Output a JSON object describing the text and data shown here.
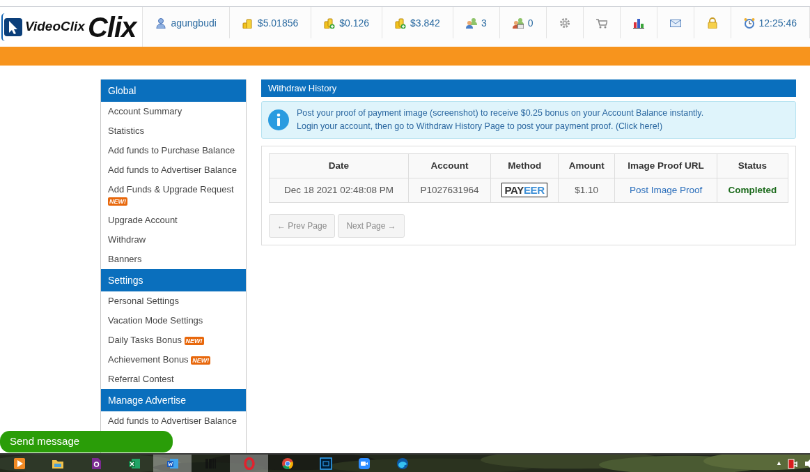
{
  "logo": {
    "label": "VideoClix",
    "wordmark": "Clix"
  },
  "header_items": [
    {
      "kind": "user",
      "text": "agungbudi"
    },
    {
      "kind": "coins",
      "text": "$5.01856"
    },
    {
      "kind": "coins-add",
      "text": "$0.126"
    },
    {
      "kind": "coins-add",
      "text": "$3.842"
    },
    {
      "kind": "referrals",
      "text": "3"
    },
    {
      "kind": "rented",
      "text": "0"
    },
    {
      "kind": "settings"
    },
    {
      "kind": "cart"
    },
    {
      "kind": "stats"
    },
    {
      "kind": "mail"
    },
    {
      "kind": "lock"
    },
    {
      "kind": "clock",
      "text": "12:25:46"
    }
  ],
  "sidebar": [
    {
      "title": "Global",
      "items": [
        {
          "label": "Account Summary"
        },
        {
          "label": "Statistics"
        },
        {
          "label": "Add funds to Purchase Balance"
        },
        {
          "label": "Add funds to Advertiser Balance"
        },
        {
          "label": "Add Funds & Upgrade Request",
          "badge": "NEW!"
        },
        {
          "label": "Upgrade Account"
        },
        {
          "label": "Withdraw"
        },
        {
          "label": "Banners"
        }
      ]
    },
    {
      "title": "Settings",
      "items": [
        {
          "label": "Personal Settings"
        },
        {
          "label": "Vacation Mode Settings"
        },
        {
          "label": "Daily Tasks Bonus",
          "badge": "NEW!"
        },
        {
          "label": "Achievement Bonus",
          "badge": "NEW!"
        },
        {
          "label": "Referral Contest"
        }
      ]
    },
    {
      "title": "Manage Advertise",
      "items": [
        {
          "label": "Add funds to Advertiser Balance"
        }
      ]
    }
  ],
  "panel": {
    "title": "Withdraw History",
    "alert": [
      "Post your proof of payment image (screenshot) to receive $0.25 bonus on your Account Balance instantly.",
      "Login your account, then go to Withdraw History Page to post your payment proof. (Click here!)"
    ],
    "table": {
      "columns": [
        "Date",
        "Account",
        "Method",
        "Amount",
        "Image Proof URL",
        "Status"
      ],
      "rows": [
        {
          "date": "Dec 18 2021 02:48:08 PM",
          "account": "P1027631964",
          "method": [
            {
              "text": "PAY",
              "color": "#333333"
            },
            {
              "text": "EER",
              "color": "#3d8fd6"
            }
          ],
          "amount": "$1.10",
          "proof_link": "Post Image Proof",
          "status": "Completed"
        }
      ]
    },
    "pagination": [
      {
        "label": "← Prev Page",
        "disabled": true
      },
      {
        "label": "Next Page →",
        "disabled": true
      }
    ]
  },
  "chat_button": "Send message",
  "taskbar": {
    "apps": [
      {
        "kind": "media",
        "selected": false
      },
      {
        "kind": "folder",
        "selected": false
      },
      {
        "kind": "document",
        "selected": false
      },
      {
        "kind": "spreadsheet",
        "selected": false
      },
      {
        "kind": "word",
        "selected": true
      },
      {
        "kind": "barcode",
        "selected": false
      },
      {
        "kind": "opera",
        "selected": true
      },
      {
        "kind": "chrome",
        "selected": false
      },
      {
        "kind": "frame",
        "selected": false
      },
      {
        "kind": "camera",
        "selected": false
      },
      {
        "kind": "edge",
        "selected": false
      }
    ],
    "tray_caret": "▲"
  }
}
